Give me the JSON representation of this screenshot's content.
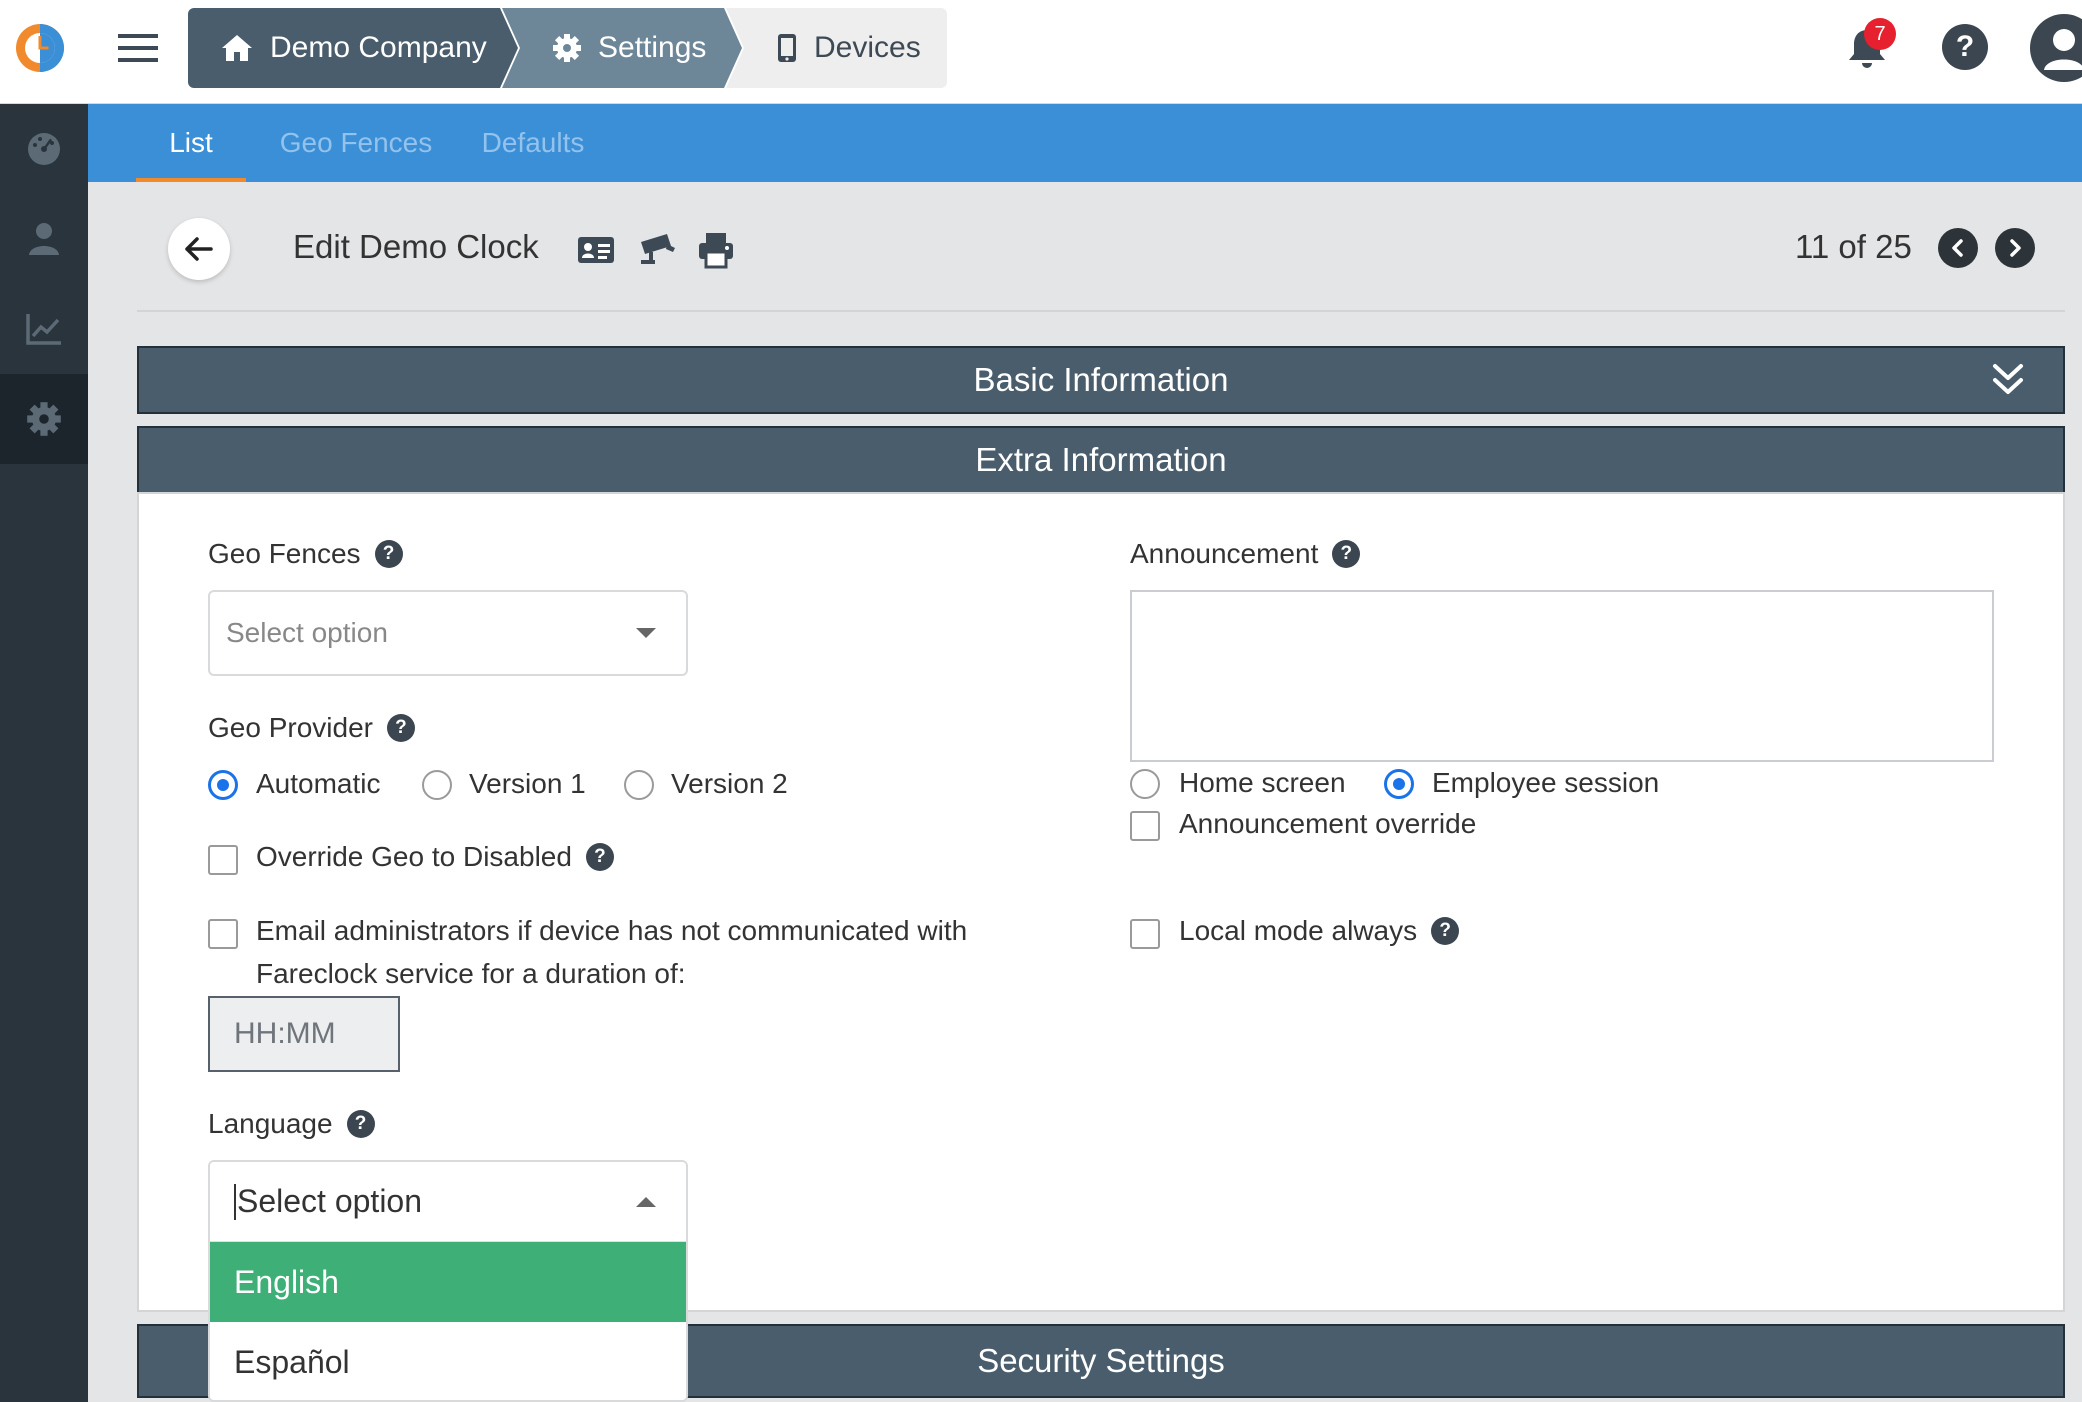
{
  "breadcrumb": {
    "items": [
      {
        "label": "Demo Company",
        "icon": "home-icon"
      },
      {
        "label": "Settings",
        "icon": "gear-icon"
      },
      {
        "label": "Devices",
        "icon": "mobile-device-icon"
      }
    ]
  },
  "notifications": {
    "count": "7"
  },
  "help_label": "?",
  "sidebar": {
    "items": [
      {
        "name": "dashboard",
        "icon": "dashboard-icon"
      },
      {
        "name": "employees",
        "icon": "user-icon"
      },
      {
        "name": "reports",
        "icon": "chart-icon"
      },
      {
        "name": "settings",
        "icon": "gear-icon",
        "active": true
      }
    ]
  },
  "subnav": {
    "tabs": [
      {
        "label": "List",
        "active": true
      },
      {
        "label": "Geo Fences"
      },
      {
        "label": "Defaults"
      }
    ]
  },
  "header": {
    "title": "Edit Demo Clock",
    "pager": "11 of 25"
  },
  "sections": {
    "basic": "Basic Information",
    "extra": "Extra Information",
    "security": "Security Settings"
  },
  "form": {
    "geo_fences": {
      "label": "Geo Fences",
      "placeholder": "Select option"
    },
    "geo_provider": {
      "label": "Geo Provider",
      "options": [
        "Automatic",
        "Version 1",
        "Version 2"
      ],
      "selected": "Automatic"
    },
    "override_geo": {
      "label": "Override Geo to Disabled",
      "checked": false
    },
    "email_admins": {
      "label_line1": "Email administrators if device has not communicated with",
      "label_line2": "Fareclock service for a duration of:",
      "checked": false,
      "duration_placeholder": "HH:MM"
    },
    "language": {
      "label": "Language",
      "placeholder": "Select option",
      "options": [
        "English",
        "Español"
      ],
      "highlighted": "English"
    },
    "announcement": {
      "label": "Announcement",
      "value": "",
      "display_options": [
        "Home screen",
        "Employee session"
      ],
      "display_selected": "Employee session",
      "override_label": "Announcement override",
      "override_checked": false
    },
    "local_mode": {
      "label": "Local mode always",
      "checked": false
    }
  },
  "colors": {
    "brand_blue": "#3a8fd6",
    "section_bar": "#4a5d6c",
    "highlight_green": "#3daf77",
    "badge_red": "#e6202e",
    "tab_underline": "#f08a2c"
  }
}
